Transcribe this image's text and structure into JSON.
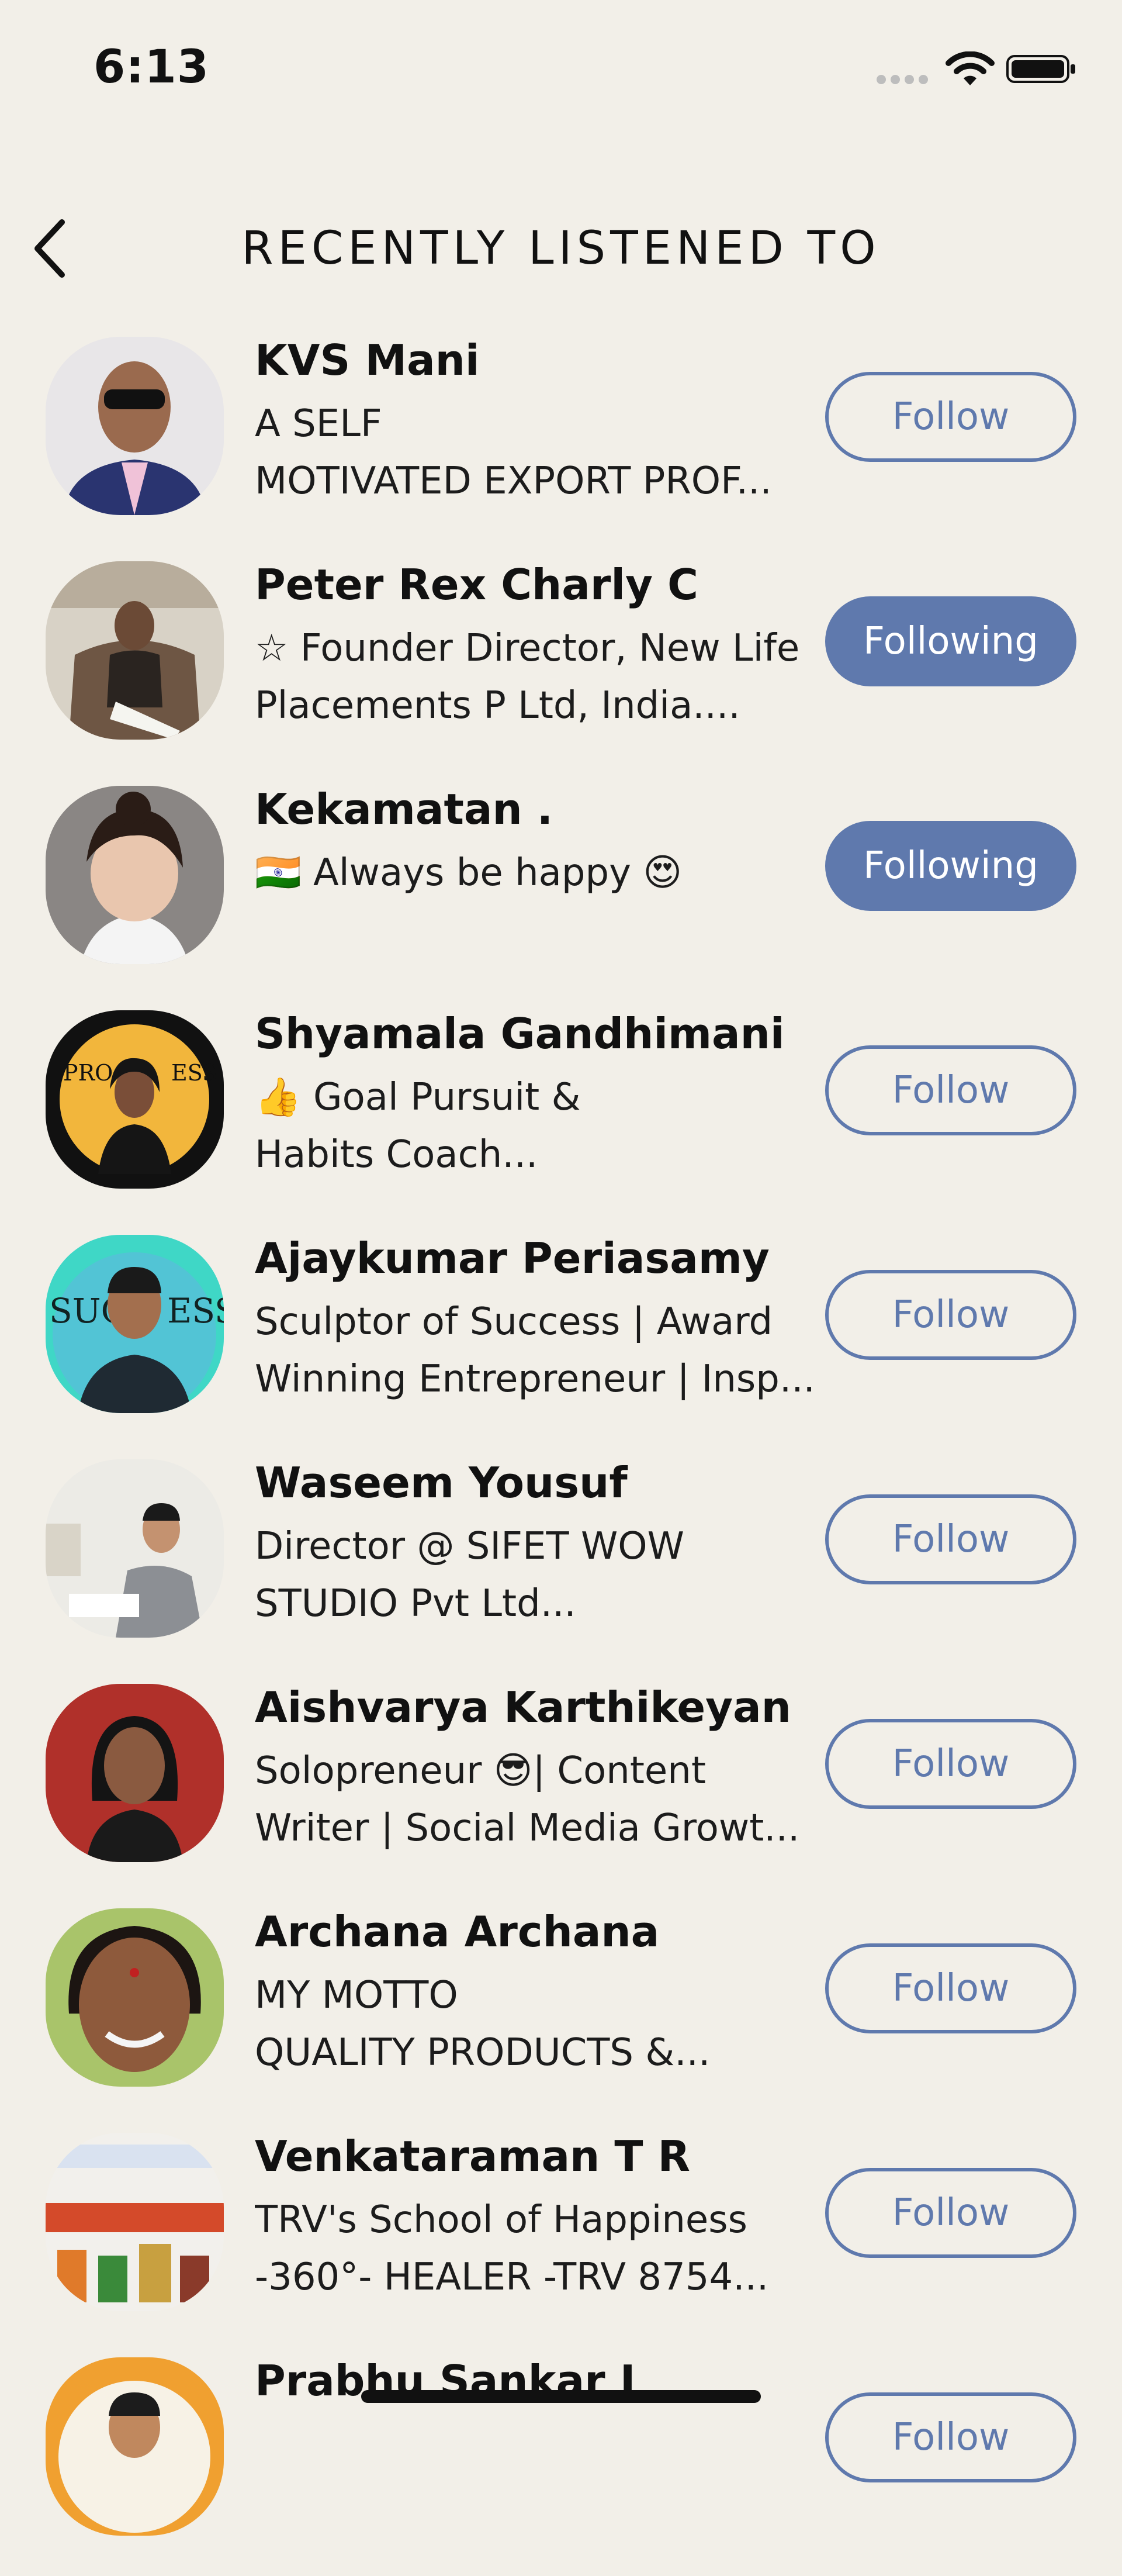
{
  "status_bar": {
    "time": "6:13"
  },
  "header": {
    "title": "RECENTLY LISTENED TO"
  },
  "colors": {
    "accent": "#5f79ad",
    "background": "#f2efe8"
  },
  "people": [
    {
      "name": "KVS Mani",
      "bio_line1": "A SELF",
      "bio_line2": "MOTIVATED EXPORT PROF...",
      "button": "Follow",
      "following": false
    },
    {
      "name": "Peter Rex Charly C",
      "bio_line1": "☆ Founder Director, New Life",
      "bio_line2": "Placements P Ltd, India....",
      "button": "Following",
      "following": true
    },
    {
      "name": "Kekamatan .",
      "bio_line1": "🇮🇳 Always be happy 😍",
      "bio_line2": "",
      "button": "Following",
      "following": true
    },
    {
      "name": "Shyamala Gandhimani",
      "bio_line1": "👍 Goal Pursuit &",
      "bio_line2": "Habits Coach...",
      "button": "Follow",
      "following": false
    },
    {
      "name": "Ajaykumar Periasamy",
      "bio_line1": "Sculptor of Success | Award",
      "bio_line2": "Winning Entrepreneur | Insp...",
      "button": "Follow",
      "following": false
    },
    {
      "name": "Waseem Yousuf",
      "bio_line1": "Director @ SIFET WOW",
      "bio_line2": "STUDIO Pvt Ltd...",
      "button": "Follow",
      "following": false
    },
    {
      "name": "Aishvarya Karthikeyan",
      "bio_line1": "Solopreneur 😎| Content",
      "bio_line2": "Writer | Social Media Growt...",
      "button": "Follow",
      "following": false
    },
    {
      "name": "Archana Archana",
      "bio_line1": "MY MOTTO",
      "bio_line2": "QUALITY PRODUCTS &...",
      "button": "Follow",
      "following": false
    },
    {
      "name": "Venkataraman T R",
      "bio_line1": "TRV's School of Happiness",
      "bio_line2": "-360°- HEALER -TRV 8754...",
      "button": "Follow",
      "following": false
    },
    {
      "name": "Prabhu Sankar I",
      "bio_line1": "",
      "bio_line2": "",
      "button": "Follow",
      "following": false
    }
  ]
}
